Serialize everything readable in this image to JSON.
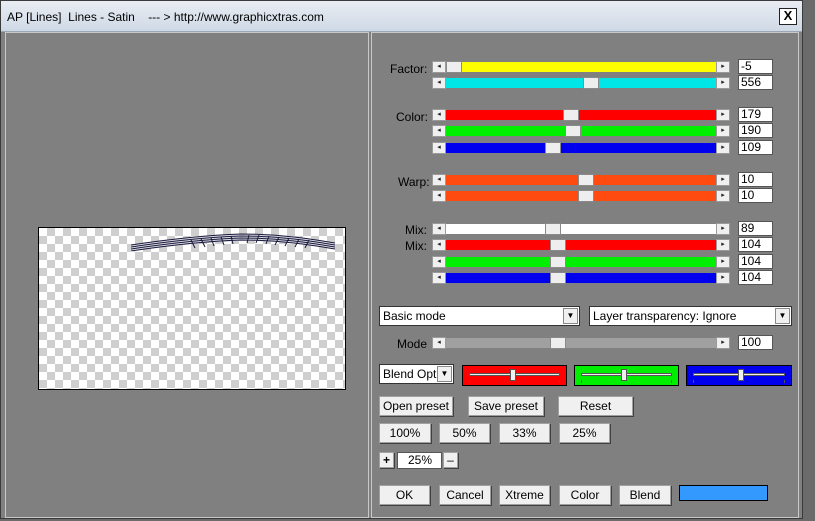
{
  "window": {
    "title": "AP [Lines]  Lines - Satin    --- > http://www.graphicxtras.com",
    "close_glyph": "X"
  },
  "labels": {
    "factor": "Factor:",
    "color": "Color:",
    "warp": "Warp:",
    "mix1": "Mix:",
    "mix2": "Mix:",
    "mode": "Mode"
  },
  "sliders": {
    "factor_1": {
      "value": "-5",
      "fraction": 0.0
    },
    "factor_2": {
      "value": "556",
      "fraction": 0.54
    },
    "color_r": {
      "value": "179",
      "fraction": 0.46
    },
    "color_g": {
      "value": "190",
      "fraction": 0.47
    },
    "color_b": {
      "value": "109",
      "fraction": 0.39
    },
    "warp_1": {
      "value": "10",
      "fraction": 0.52
    },
    "warp_2": {
      "value": "10",
      "fraction": 0.52
    },
    "mix_1": {
      "value": "89",
      "fraction": 0.39
    },
    "mix_2": {
      "value": "104",
      "fraction": 0.41
    },
    "mix_3": {
      "value": "104",
      "fraction": 0.41
    },
    "mix_4": {
      "value": "104",
      "fraction": 0.41
    },
    "mode": {
      "value": "100",
      "fraction": 0.41
    }
  },
  "colors": {
    "yellow": "#ffff00",
    "cyan": "#00e5e5",
    "red": "#ff0000",
    "green": "#00ee00",
    "blue": "#0000ee",
    "orange": "#ff4a10",
    "white": "#ffffff",
    "gray": "#a0a0a0",
    "swatch_blue": "#3399ff"
  },
  "dropdowns": {
    "mode": "Basic mode",
    "transparency": "Layer transparency: Ignore",
    "blend": "Blend Optio"
  },
  "color_sliders": {
    "red": 0.46,
    "green": 0.45,
    "blue": 0.5
  },
  "buttons": {
    "open_preset": "Open preset",
    "save_preset": "Save preset",
    "reset": "Reset",
    "zoom_100": "100%",
    "zoom_50": "50%",
    "zoom_33": "33%",
    "zoom_25": "25%",
    "plus": "+",
    "minus": "–",
    "zoom_value": "25%",
    "ok": "OK",
    "cancel": "Cancel",
    "xtreme": "Xtreme",
    "color": "Color",
    "blend": "Blend"
  },
  "icons": {
    "arrow_left": "◂",
    "arrow_right": "▸",
    "dropdown": "▼"
  }
}
